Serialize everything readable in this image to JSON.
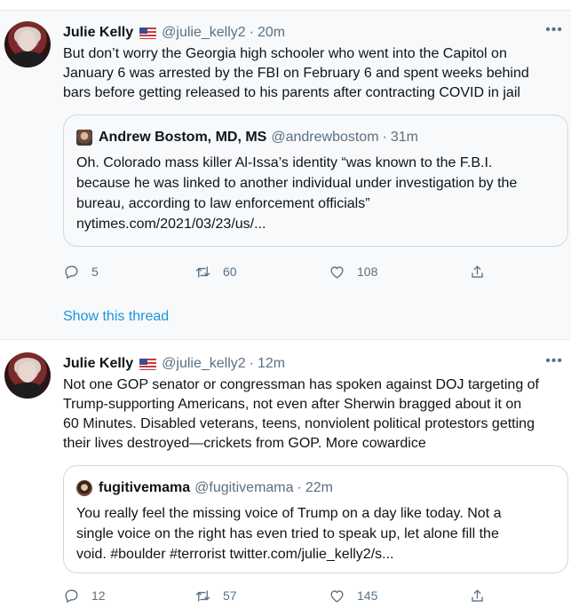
{
  "tweets": [
    {
      "author_name": "Julie Kelly",
      "flag_icon": "us-flag-icon",
      "handle": "@julie_kelly2",
      "separator": "·",
      "time": "20m",
      "more": "•••",
      "text_lines": [
        "But don’t worry the Georgia high schooler who went into the Capitol on",
        "January 6 was arrested by the FBI on February 6 and spent weeks behind",
        "bars before getting released to his parents after contracting COVID in jail"
      ],
      "quote": {
        "author_name": "Andrew Bostom, MD, MS",
        "handle": "@andrewbostom",
        "separator": "·",
        "time": "31m",
        "text_lines": [
          "Oh. Colorado mass killer Al-Issa’s  identity “was known to the F.B.I.",
          "because he was linked to another individual under investigation by the",
          "bureau, according to law enforcement officials”",
          "nytimes.com/2021/03/23/us/..."
        ]
      },
      "replies": "5",
      "retweets": "60",
      "likes": "108",
      "show_thread": "Show this thread"
    },
    {
      "author_name": "Julie Kelly",
      "flag_icon": "us-flag-icon",
      "handle": "@julie_kelly2",
      "separator": "·",
      "time": "12m",
      "more": "•••",
      "text_lines": [
        "Not one GOP senator or congressman has spoken against DOJ targeting of",
        "Trump-supporting Americans, not even after Sherwin bragged about it on",
        "60 Minutes. Disabled veterans, teens, nonviolent political protestors getting",
        "their lives destroyed—crickets from GOP. More cowardice"
      ],
      "quote": {
        "author_name": "fugitivemama",
        "handle": "@fugitivemama",
        "separator": "·",
        "time": "22m",
        "text_lines": [
          "You really feel the missing voice of Trump on a day like today. Not a",
          "single voice on the right has even tried to speak up, let alone fill the",
          "void. #boulder #terrorist twitter.com/julie_kelly2/s..."
        ]
      },
      "replies": "12",
      "retweets": "57",
      "likes": "145"
    }
  ],
  "colors": {
    "link": "#1b95e0",
    "muted": "#5b7083",
    "text": "#0f1419",
    "border": "#cfd9de",
    "highlight_bg": "#f7f9fa"
  },
  "icons": {
    "reply": "reply-icon",
    "retweet": "retweet-icon",
    "like": "heart-icon",
    "share": "share-icon"
  }
}
